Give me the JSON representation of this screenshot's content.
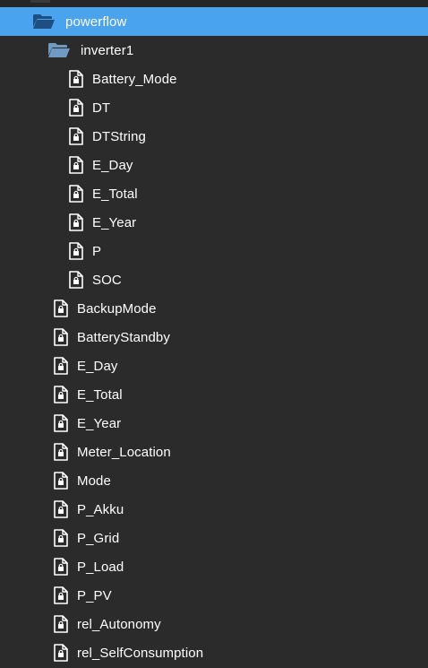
{
  "tree": {
    "root": {
      "label": "powerflow",
      "icon": "folder-open-icon",
      "selected": true
    },
    "inverter": {
      "label": "inverter1",
      "icon": "folder-open-icon"
    },
    "inverter_items": [
      {
        "label": "Battery_Mode",
        "icon": "locked-file-icon"
      },
      {
        "label": "DT",
        "icon": "locked-file-icon"
      },
      {
        "label": "DTString",
        "icon": "locked-file-icon"
      },
      {
        "label": "E_Day",
        "icon": "locked-file-icon"
      },
      {
        "label": "E_Total",
        "icon": "locked-file-icon"
      },
      {
        "label": "E_Year",
        "icon": "locked-file-icon"
      },
      {
        "label": "P",
        "icon": "locked-file-icon"
      },
      {
        "label": "SOC",
        "icon": "locked-file-icon"
      }
    ],
    "powerflow_items": [
      {
        "label": "BackupMode",
        "icon": "locked-file-icon"
      },
      {
        "label": "BatteryStandby",
        "icon": "locked-file-icon"
      },
      {
        "label": "E_Day",
        "icon": "locked-file-icon"
      },
      {
        "label": "E_Total",
        "icon": "locked-file-icon"
      },
      {
        "label": "E_Year",
        "icon": "locked-file-icon"
      },
      {
        "label": "Meter_Location",
        "icon": "locked-file-icon"
      },
      {
        "label": "Mode",
        "icon": "locked-file-icon"
      },
      {
        "label": "P_Akku",
        "icon": "locked-file-icon"
      },
      {
        "label": "P_Grid",
        "icon": "locked-file-icon"
      },
      {
        "label": "P_Load",
        "icon": "locked-file-icon"
      },
      {
        "label": "P_PV",
        "icon": "locked-file-icon"
      },
      {
        "label": "rel_Autonomy",
        "icon": "locked-file-icon"
      },
      {
        "label": "rel_SelfConsumption",
        "icon": "locked-file-icon"
      }
    ]
  },
  "colors": {
    "background": "#2b2b2b",
    "selected_row": "#4aa3ef",
    "text": "#ffffff",
    "folder_selected": "#1f4f80",
    "folder": "#6f9ac4"
  }
}
